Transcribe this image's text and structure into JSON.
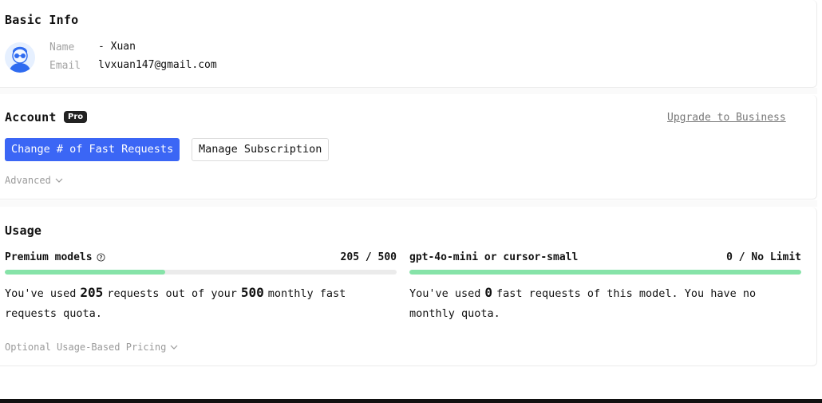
{
  "basic_info": {
    "title": "Basic Info",
    "name_label": "Name",
    "name_value": "- Xuan",
    "email_label": "Email",
    "email_value": "lvxuan147@gmail.com"
  },
  "account": {
    "title": "Account",
    "plan_badge": "Pro",
    "upgrade_link": "Upgrade to Business",
    "change_requests_button": "Change # of Fast Requests",
    "manage_subscription_button": "Manage Subscription",
    "advanced_toggle": "Advanced"
  },
  "usage": {
    "title": "Usage",
    "premium": {
      "name": "Premium models",
      "count": "205 / 500",
      "used": 205,
      "limit": 500,
      "progress": 0.41,
      "desc_prefix": "You've used",
      "used_text": "205",
      "desc_middle": "requests out of your",
      "limit_text": "500",
      "desc_suffix": "monthly fast requests quota."
    },
    "small": {
      "name": "gpt-4o-mini or cursor-small",
      "count": "0 / No Limit",
      "progress": 1.0,
      "desc_prefix": "You've used",
      "used_text": "0",
      "desc_suffix": "fast requests of this model. You have no monthly quota."
    },
    "optional_pricing_toggle": "Optional Usage-Based Pricing"
  },
  "colors": {
    "primary": "#3b66f5",
    "progress_green": "#86e3a8",
    "badge_bg": "#222222"
  }
}
